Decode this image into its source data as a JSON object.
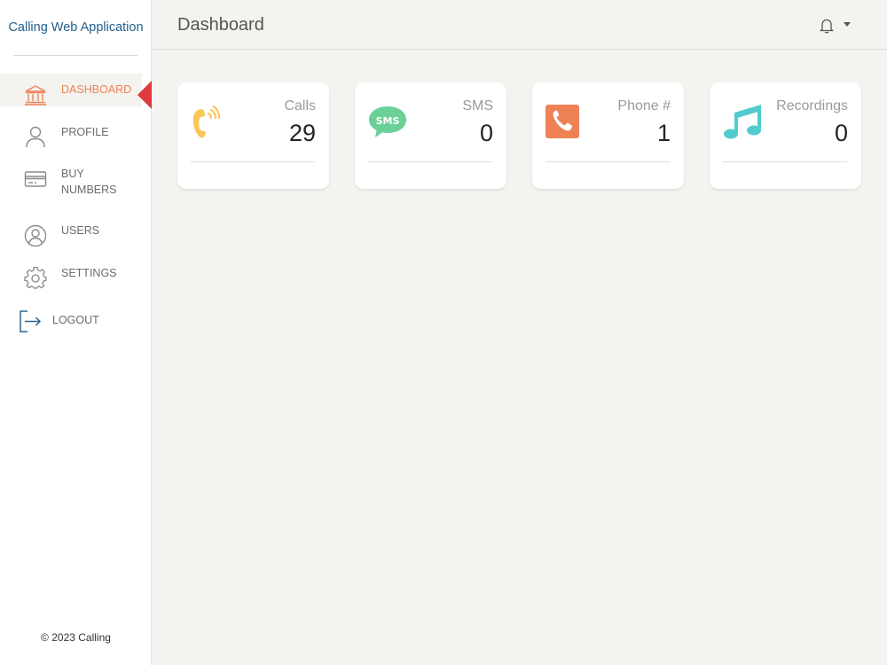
{
  "app": {
    "brand": "Calling Web Application",
    "copyright": "© 2023 Calling"
  },
  "sidebar": {
    "items": [
      {
        "label": "DASHBOARD",
        "icon": "bank-icon",
        "active": true
      },
      {
        "label": "PROFILE",
        "icon": "user-icon",
        "active": false
      },
      {
        "label": "BUY NUMBERS",
        "icon": "credit-card-icon",
        "active": false
      },
      {
        "label": "USERS",
        "icon": "user-circle-icon",
        "active": false
      },
      {
        "label": "SETTINGS",
        "icon": "gear-icon",
        "active": false
      },
      {
        "label": "LOGOUT",
        "icon": "logout-icon",
        "active": false
      }
    ],
    "active_color": "#ef8157",
    "active_marker_color": "#e0393e"
  },
  "header": {
    "title": "Dashboard",
    "notification_icon": "bell-icon"
  },
  "stats": [
    {
      "label": "Calls",
      "value": "29",
      "icon": "phone-ringing-icon",
      "color": "#fbc658"
    },
    {
      "label": "SMS",
      "value": "0",
      "icon": "sms-bubble-icon",
      "color": "#6bd098"
    },
    {
      "label": "Phone #",
      "value": "1",
      "icon": "phone-square-icon",
      "color": "#ef8157"
    },
    {
      "label": "Recordings",
      "value": "0",
      "icon": "music-note-icon",
      "color": "#51cbce"
    }
  ]
}
